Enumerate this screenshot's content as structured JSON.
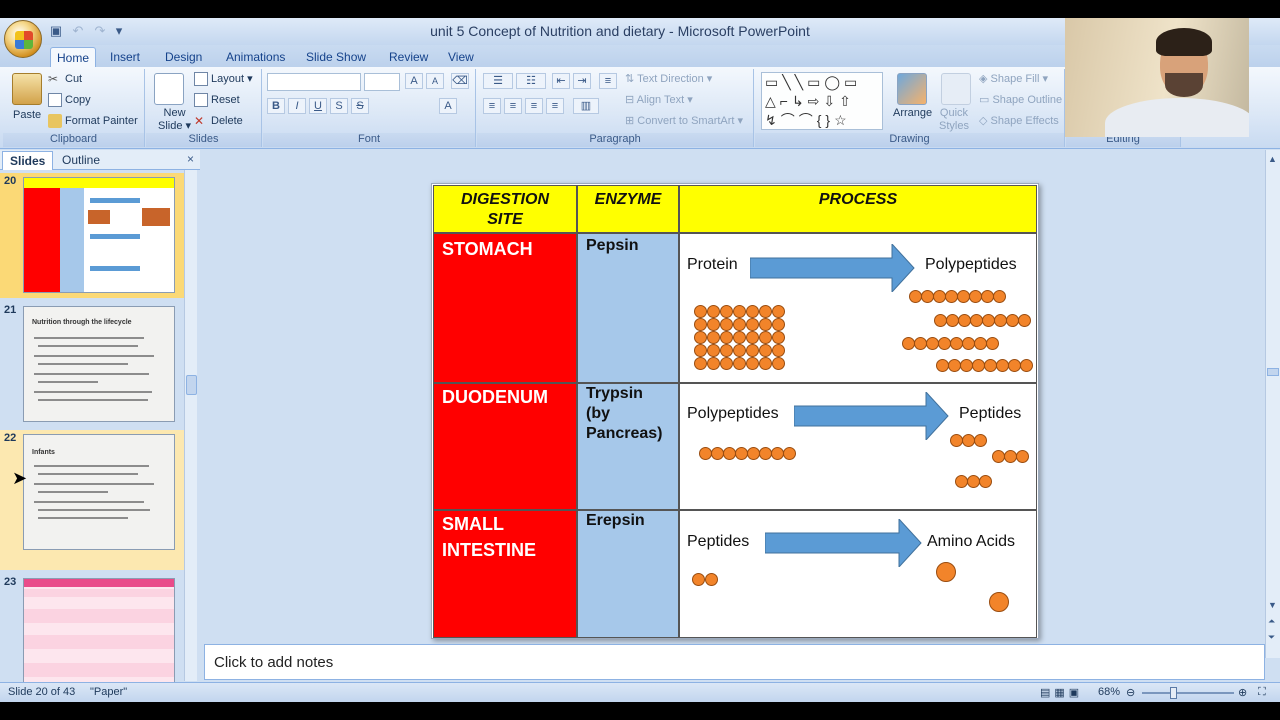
{
  "window": {
    "title": "unit 5 Concept of Nutrition and dietary - Microsoft PowerPoint"
  },
  "ribbon": {
    "tabs": [
      "Home",
      "Insert",
      "Design",
      "Animations",
      "Slide Show",
      "Review",
      "View"
    ],
    "clipboard": {
      "paste": "Paste",
      "cut": "Cut",
      "copy": "Copy",
      "format_painter": "Format Painter",
      "label": "Clipboard"
    },
    "slides": {
      "new_slide_1": "New",
      "new_slide_2": "Slide",
      "layout": "Layout",
      "reset": "Reset",
      "delete": "Delete",
      "label": "Slides"
    },
    "font": {
      "label": "Font",
      "bold": "B",
      "italic": "I",
      "underline": "U",
      "strike": "S",
      "shadow": "S",
      "grow": "A",
      "shrink": "A"
    },
    "paragraph": {
      "text_direction": "Text Direction",
      "align_text": "Align Text",
      "convert_smartart": "Convert to SmartArt",
      "label": "Paragraph"
    },
    "drawing": {
      "arrange": "Arrange",
      "quick_styles_1": "Quick",
      "quick_styles_2": "Styles",
      "shape_fill": "Shape Fill",
      "shape_outline": "Shape Outline",
      "shape_effects": "Shape Effects",
      "label": "Drawing"
    },
    "editing": {
      "label": "Editing"
    }
  },
  "slides_pane": {
    "tabs": [
      "Slides",
      "Outline"
    ],
    "close": "×",
    "thumbnails": [
      {
        "number": "20"
      },
      {
        "number": "21",
        "title": "Nutrition through the lifecycle"
      },
      {
        "number": "22",
        "title": "Infants"
      },
      {
        "number": "23"
      }
    ]
  },
  "slide": {
    "headers": [
      "DIGESTION SITE",
      "ENZYME",
      "PROCESS"
    ],
    "rows": [
      {
        "site": "STOMACH",
        "enzyme": "Pepsin",
        "from": "Protein",
        "to": "Polypeptides"
      },
      {
        "site": "DUODENUM",
        "enzyme": "Trypsin (by Pancreas)",
        "from": "Polypeptides",
        "to": "Peptides"
      },
      {
        "site": "SMALL INTESTINE",
        "enzyme": "Erepsin",
        "from": "Peptides",
        "to": "Amino Acids"
      }
    ]
  },
  "notes": {
    "placeholder": "Click to add notes"
  },
  "status": {
    "slide": "Slide 20 of 43",
    "theme": "\"Paper\"",
    "zoom": "68%"
  },
  "colors": {
    "site_bg": "#ff0000",
    "enzyme_bg": "#a6c8ea",
    "header_bg": "#ffff00",
    "arrow": "#5b9bd5",
    "dot": "#f2842a"
  }
}
